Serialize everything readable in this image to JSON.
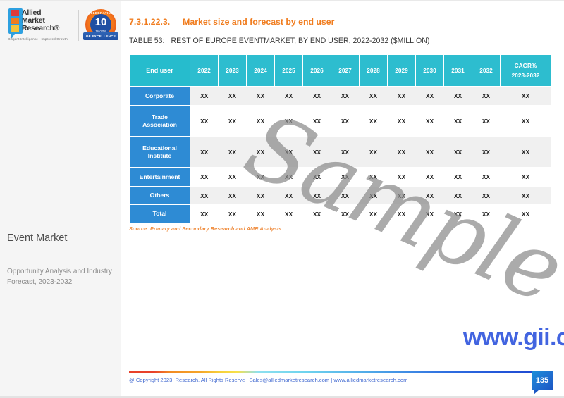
{
  "brand": {
    "logo_words": [
      "Allied",
      "Market",
      "Research®"
    ],
    "tagline": "Diligent Intelligence - Improved Growth",
    "badge": {
      "top_text": "CELEBRATING",
      "number": "10",
      "years_label": "YEARS",
      "ribbon_text": "OF EXCELLENCE"
    }
  },
  "sidebar": {
    "report_title": "Event Market",
    "report_subtitle": "Opportunity Analysis and Industry Forecast, 2023-2032"
  },
  "heading": {
    "number": "7.3.1.22.3.",
    "title": "Market size and forecast by end user"
  },
  "table_caption": {
    "label": "TABLE 53:",
    "text": "REST OF EUROPE EVENTMARKET, BY END USER, 2022-2032 ($MILLION)"
  },
  "chart_data": {
    "type": "table",
    "title": "REST OF EUROPE EVENTMARKET, BY END USER, 2022-2032 ($MILLION)",
    "columns": [
      "End user",
      "2022",
      "2023",
      "2024",
      "2025",
      "2026",
      "2027",
      "2028",
      "2029",
      "2030",
      "2031",
      "2032",
      "CAGR%\n2023-2032"
    ],
    "header_cagr_line1": "CAGR%",
    "header_cagr_line2": "2023-2032",
    "categories": [
      "Corporate",
      "Trade Association",
      "Educational Institute",
      "Entertainment",
      "Others",
      "Total"
    ],
    "rows": [
      {
        "label": "Corporate",
        "label_line1": "Corporate",
        "label_line2": "",
        "values": [
          "XX",
          "XX",
          "XX",
          "XX",
          "XX",
          "XX",
          "XX",
          "XX",
          "XX",
          "XX",
          "XX",
          "XX"
        ]
      },
      {
        "label": "Trade Association",
        "label_line1": "Trade",
        "label_line2": "Association",
        "values": [
          "XX",
          "XX",
          "XX",
          "XX",
          "XX",
          "XX",
          "XX",
          "XX",
          "XX",
          "XX",
          "XX",
          "XX"
        ]
      },
      {
        "label": "Educational Institute",
        "label_line1": "Educational",
        "label_line2": "Institute",
        "values": [
          "XX",
          "XX",
          "XX",
          "XX",
          "XX",
          "XX",
          "XX",
          "XX",
          "XX",
          "XX",
          "XX",
          "XX"
        ]
      },
      {
        "label": "Entertainment",
        "label_line1": "Entertainment",
        "label_line2": "",
        "values": [
          "XX",
          "XX",
          "XX",
          "XX",
          "XX",
          "XX",
          "XX",
          "XX",
          "XX",
          "XX",
          "XX",
          "XX"
        ]
      },
      {
        "label": "Others",
        "label_line1": "Others",
        "label_line2": "",
        "values": [
          "XX",
          "XX",
          "XX",
          "XX",
          "XX",
          "XX",
          "XX",
          "XX",
          "XX",
          "XX",
          "XX",
          "XX"
        ]
      },
      {
        "label": "Total",
        "label_line1": "Total",
        "label_line2": "",
        "values": [
          "XX",
          "XX",
          "XX",
          "XX",
          "XX",
          "XX",
          "XX",
          "XX",
          "XX",
          "XX",
          "XX",
          "XX"
        ]
      }
    ],
    "source_note": "Source: Primary and Secondary Research and AMR Analysis"
  },
  "watermarks": {
    "sample": "Sample",
    "url": "www.gii.co.jp"
  },
  "footer": {
    "copyright": "@ Copyright 2023, Research. All Rights Reserve | Sales@alliedmarketresearch.com | www.alliedmarketresearch.com",
    "page_number": "135"
  },
  "colors": {
    "header_teal": "#2dbdcf",
    "row_label_blue": "#2e8bd4",
    "heading_orange": "#f07c1e",
    "source_orange": "#ef8b3c",
    "url_blue": "#4264e0",
    "footer_blue": "#4169d0"
  }
}
